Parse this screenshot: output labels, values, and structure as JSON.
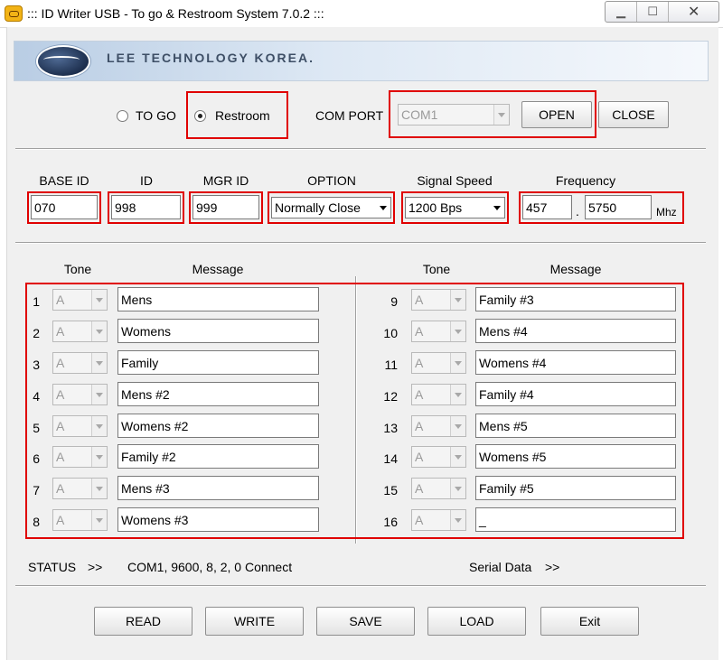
{
  "window": {
    "title": "::: ID Writer USB - To go & Restroom System 7.0.2 :::",
    "min": "▁",
    "max": "☐",
    "close": "✕"
  },
  "banner": {
    "text": "LEE TECHNOLOGY KOREA."
  },
  "mode": {
    "togo_label": "TO GO",
    "restroom_label": "Restroom",
    "selected": "Restroom"
  },
  "comport": {
    "label": "COM PORT",
    "value": "COM1",
    "open_label": "OPEN",
    "close_label": "CLOSE"
  },
  "settings": {
    "base_id_label": "BASE ID",
    "base_id": "070",
    "id_label": "ID",
    "id": "998",
    "mgr_id_label": "MGR ID",
    "mgr_id": "999",
    "option_label": "OPTION",
    "option": "Normally Close",
    "speed_label": "Signal Speed",
    "speed": "1200 Bps",
    "freq_label": "Frequency",
    "freq_int": "457",
    "freq_dot": ".",
    "freq_dec": "5750",
    "freq_unit": "Mhz"
  },
  "messages": {
    "tone_header": "Tone",
    "message_header": "Message",
    "rows": [
      {
        "num": "1",
        "tone": "A",
        "message": "Mens"
      },
      {
        "num": "2",
        "tone": "A",
        "message": "Womens"
      },
      {
        "num": "3",
        "tone": "A",
        "message": "Family"
      },
      {
        "num": "4",
        "tone": "A",
        "message": "Mens #2"
      },
      {
        "num": "5",
        "tone": "A",
        "message": "Womens #2"
      },
      {
        "num": "6",
        "tone": "A",
        "message": "Family #2"
      },
      {
        "num": "7",
        "tone": "A",
        "message": "Mens #3"
      },
      {
        "num": "8",
        "tone": "A",
        "message": "Womens #3"
      },
      {
        "num": "9",
        "tone": "A",
        "message": "Family #3"
      },
      {
        "num": "10",
        "tone": "A",
        "message": "Mens #4"
      },
      {
        "num": "11",
        "tone": "A",
        "message": "Womens #4"
      },
      {
        "num": "12",
        "tone": "A",
        "message": "Family #4"
      },
      {
        "num": "13",
        "tone": "A",
        "message": "Mens #5"
      },
      {
        "num": "14",
        "tone": "A",
        "message": "Womens #5"
      },
      {
        "num": "15",
        "tone": "A",
        "message": "Family #5"
      },
      {
        "num": "16",
        "tone": "A",
        "message": "_"
      }
    ]
  },
  "status": {
    "label": "STATUS",
    "arrow": ">>",
    "text": "COM1, 9600, 8, 2, 0 Connect",
    "serial_label": "Serial Data",
    "serial_arrow": ">>"
  },
  "actions": {
    "read": "READ",
    "write": "WRITE",
    "save": "SAVE",
    "load": "LOAD",
    "exit": "Exit"
  },
  "colors": {
    "highlight": "#e00000",
    "dialog_bg": "#f0f0f0"
  }
}
